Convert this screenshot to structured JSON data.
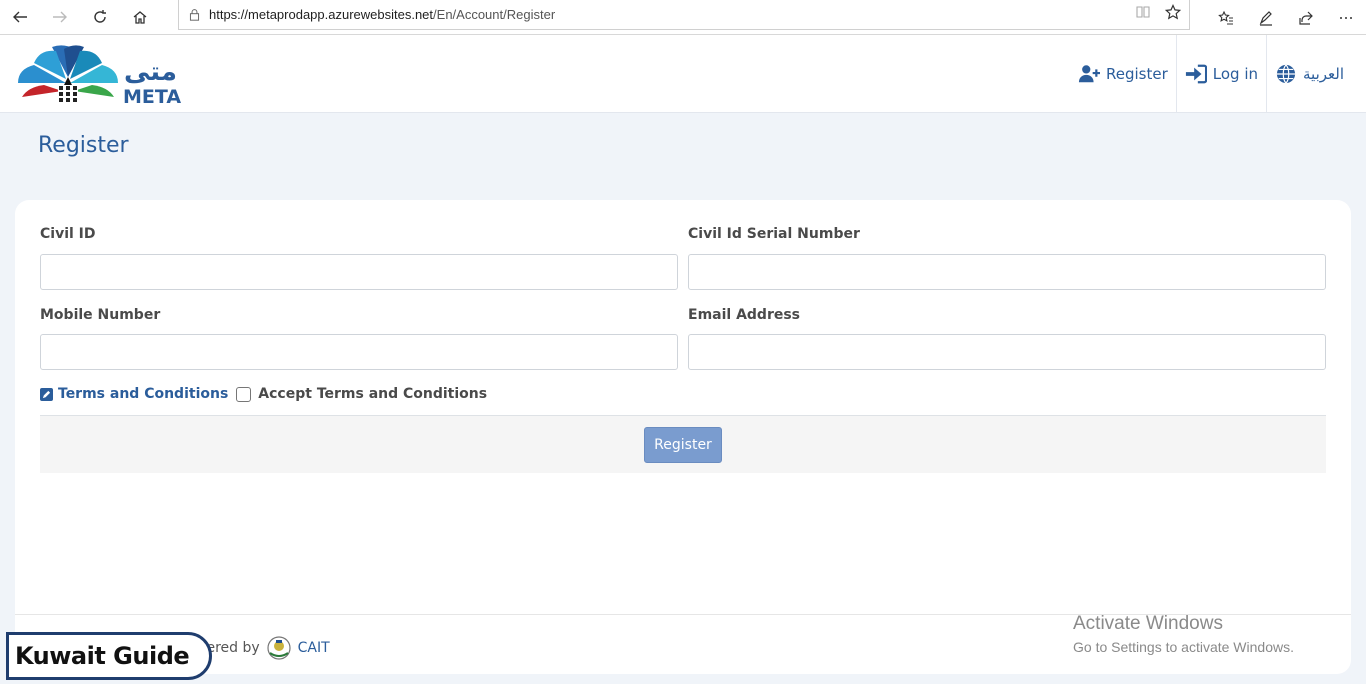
{
  "browser": {
    "url_host": "https://metaprodapp.azurewebsites.net",
    "url_path": "/En/Account/Register"
  },
  "header": {
    "logo_text": "META",
    "logo_arabic": "متى",
    "nav": [
      {
        "label": "Register",
        "icon": "user-plus-icon"
      },
      {
        "label": "Log in",
        "icon": "sign-in-icon"
      },
      {
        "label": "العربية",
        "icon": "globe-icon"
      }
    ]
  },
  "page": {
    "title": "Register"
  },
  "form": {
    "civil_id_label": "Civil ID",
    "civil_id_value": "",
    "serial_label": "Civil Id Serial Number",
    "serial_value": "",
    "mobile_label": "Mobile Number",
    "mobile_value": "",
    "email_label": "Email Address",
    "email_value": "",
    "terms_link": "Terms and Conditions",
    "accept_label": "Accept Terms and Conditions",
    "accept_checked": false,
    "submit_label": "Register"
  },
  "footer": {
    "powered_by": "wered by",
    "cait": "CAIT"
  },
  "overlay": {
    "activate_title": "Activate Windows",
    "activate_sub": "Go to Settings to activate Windows.",
    "badge": "Kuwait Guide"
  },
  "colors": {
    "brand": "#2b5d9b",
    "button": "#7a9ccf",
    "page_bg": "#f0f4f9"
  }
}
